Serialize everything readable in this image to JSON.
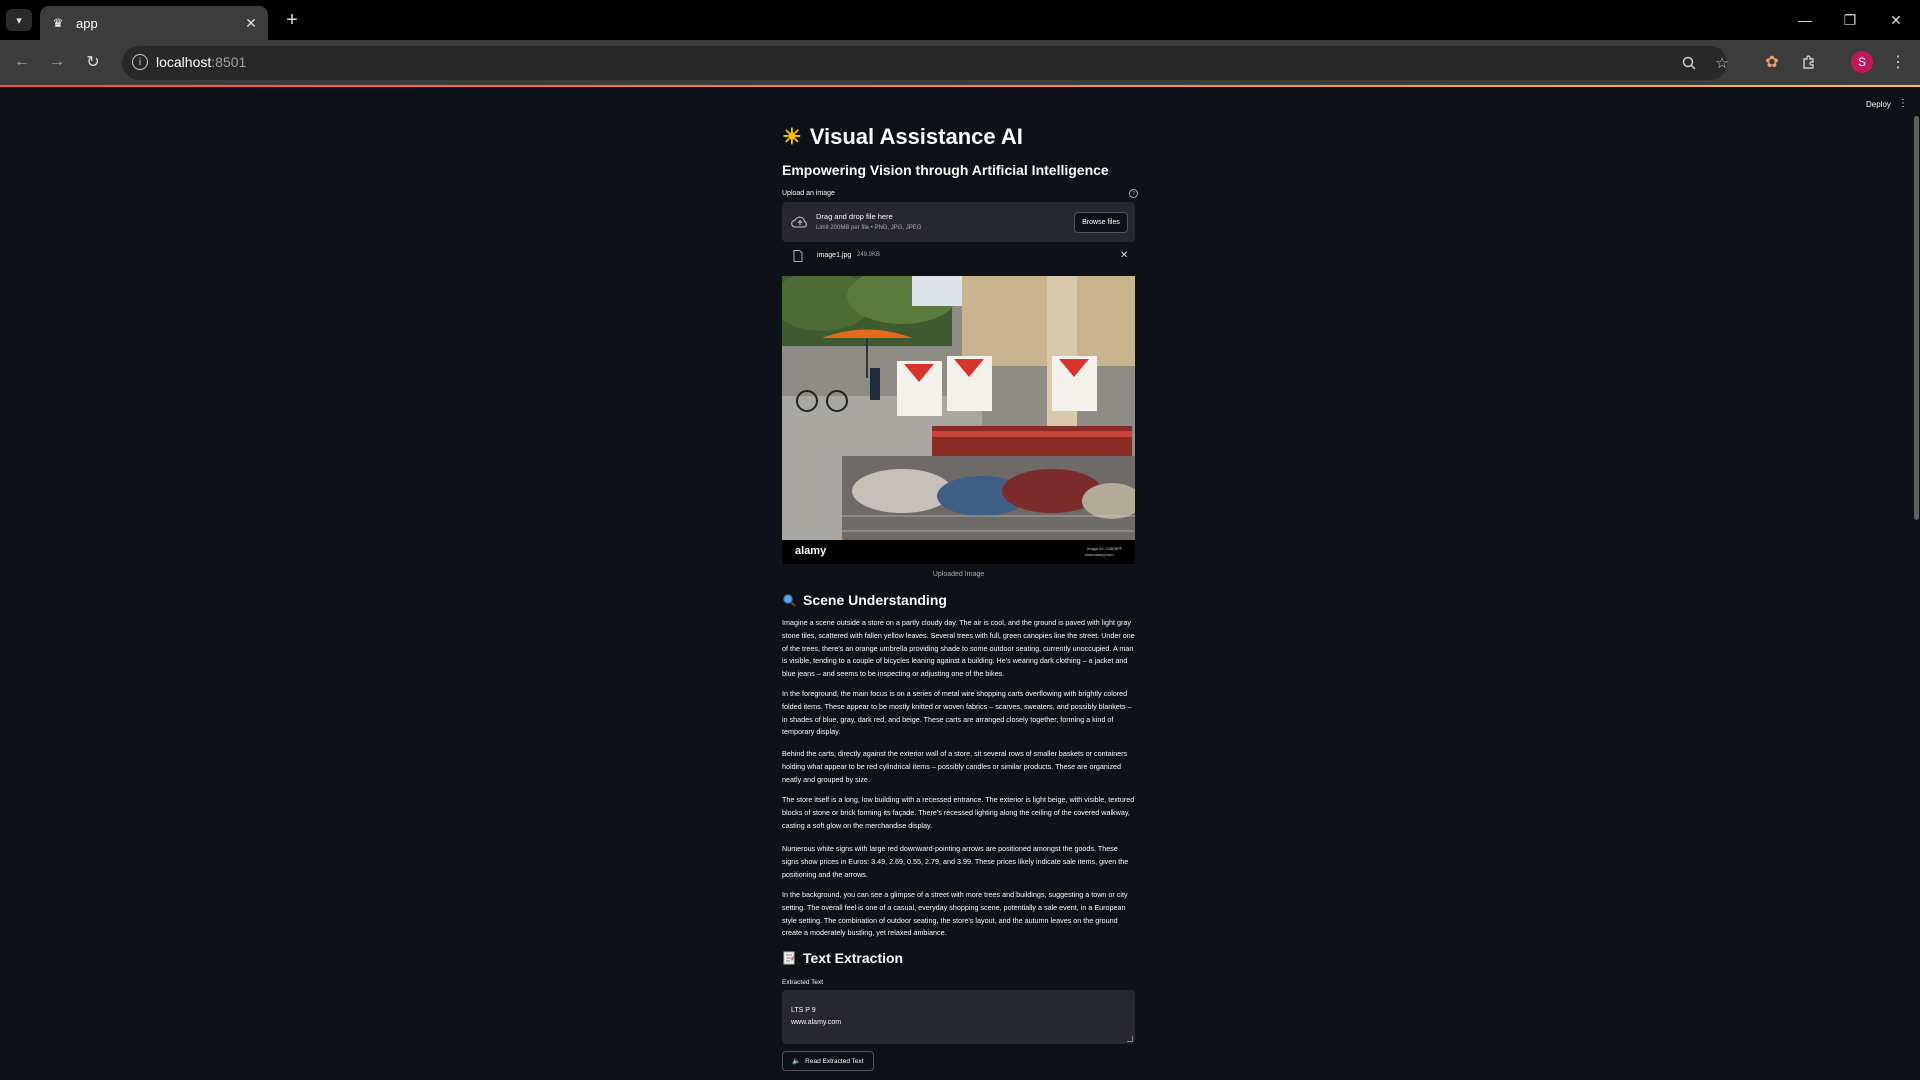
{
  "browser": {
    "tab_title": "app",
    "url_host": "localhost",
    "url_port": ":8501",
    "profile_initial": "S"
  },
  "header": {
    "deploy_label": "Deploy"
  },
  "app": {
    "title": "Visual Assistance AI",
    "subtitle": "Empowering Vision through Artificial Intelligence",
    "upload_label": "Upload an image",
    "dropzone_title": "Drag and drop file here",
    "dropzone_limit": "Limit 200MB per file • PNG, JPG, JPEG",
    "browse_label": "Browse files",
    "file_name": "image1.jpg",
    "file_size": "249.0KB",
    "image_caption": "Uploaded Image",
    "image_watermark": "alamy",
    "image_id": "Image ID: 2J8D6PF",
    "image_url": "www.alamy.com"
  },
  "scene": {
    "heading": "Scene Understanding",
    "paragraphs": [
      "Imagine a scene outside a store on a partly cloudy day. The air is cool, and the ground is paved with light gray stone tiles, scattered with fallen yellow leaves. Several trees with full, green canopies line the street. Under one of the trees, there's an orange umbrella providing shade to some outdoor seating, currently unoccupied. A man is visible, tending to a couple of bicycles leaning against a building. He's wearing dark clothing – a jacket and blue jeans – and seems to be inspecting or adjusting one of the bikes.",
      "In the foreground, the main focus is on a series of metal wire shopping carts overflowing with brightly colored folded items. These appear to be mostly knitted or woven fabrics – scarves, sweaters, and possibly blankets – in shades of blue, gray, dark red, and beige. These carts are arranged closely together, forming a kind of temporary display.",
      "Behind the carts, directly against the exterior wall of a store, sit several rows of smaller baskets or containers holding what appear to be red cylindrical items – possibly candles or similar products. These are organized neatly and grouped by size.",
      "The store itself is a long, low building with a recessed entrance. The exterior is light beige, with visible, textured blocks of stone or brick forming its façade. There's recessed lighting along the ceiling of the covered walkway, casting a soft glow on the merchandise display.",
      "Numerous white signs with large red downward-pointing arrows are positioned amongst the goods. These signs show prices in Euros: 3.49, 2.69, 0.55, 2.79, and 3.99. These prices likely indicate sale items, given the positioning and the arrows.",
      "In the background, you can see a glimpse of a street with more trees and buildings, suggesting a town or city setting. The overall feel is one of a casual, everyday shopping scene, potentially a sale event, in a European style setting. The combination of outdoor seating, the store's layout, and the autumn leaves on the ground create a moderately bustling, yet relaxed ambiance."
    ]
  },
  "extraction": {
    "heading": "Text Extraction",
    "label": "Extracted Text",
    "lines": [
      "LTS P 9",
      "www.alamy.com"
    ],
    "read_button": "Read Extracted Text"
  },
  "icons": {
    "sun": "sun-icon",
    "search": "magnifier-icon",
    "memo": "memo-icon",
    "speaker": "speaker-icon"
  }
}
